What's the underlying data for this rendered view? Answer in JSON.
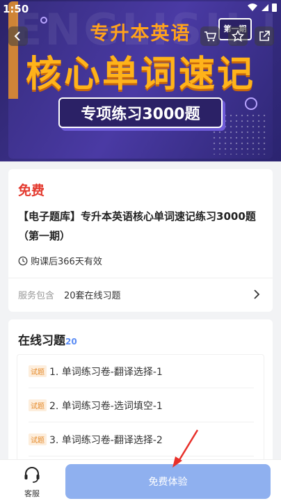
{
  "status_bar": {
    "time": "1:50"
  },
  "banner": {
    "bg_text": "ENGLISH ENGLISH ENGLISH",
    "title_line1": "专升本英语",
    "title_line2": "核心单词速记",
    "subtitle": "专项练习3000题",
    "edition": "第一期"
  },
  "product": {
    "price": "免费",
    "title": "【电子题库】专升本英语核心单词速记练习3000题（第一期）",
    "validity": "购课后366天有效",
    "service_label": "服务包含",
    "service_value": "20套在线习题"
  },
  "exercises": {
    "title": "在线习题",
    "count": "20",
    "items": [
      {
        "tag": "试题",
        "text": "1. 单词练习卷-翻译选择-1"
      },
      {
        "tag": "试题",
        "text": "2. 单词练习卷-选词填空-1"
      },
      {
        "tag": "试题",
        "text": "3. 单词练习卷-翻译选择-2"
      }
    ]
  },
  "bottom_bar": {
    "customer_service_label": "客服",
    "free_trial_label": "免费体验"
  },
  "colors": {
    "accent": "#e43a2f",
    "button": "#8fb0ef",
    "banner": "#3a2f86"
  }
}
